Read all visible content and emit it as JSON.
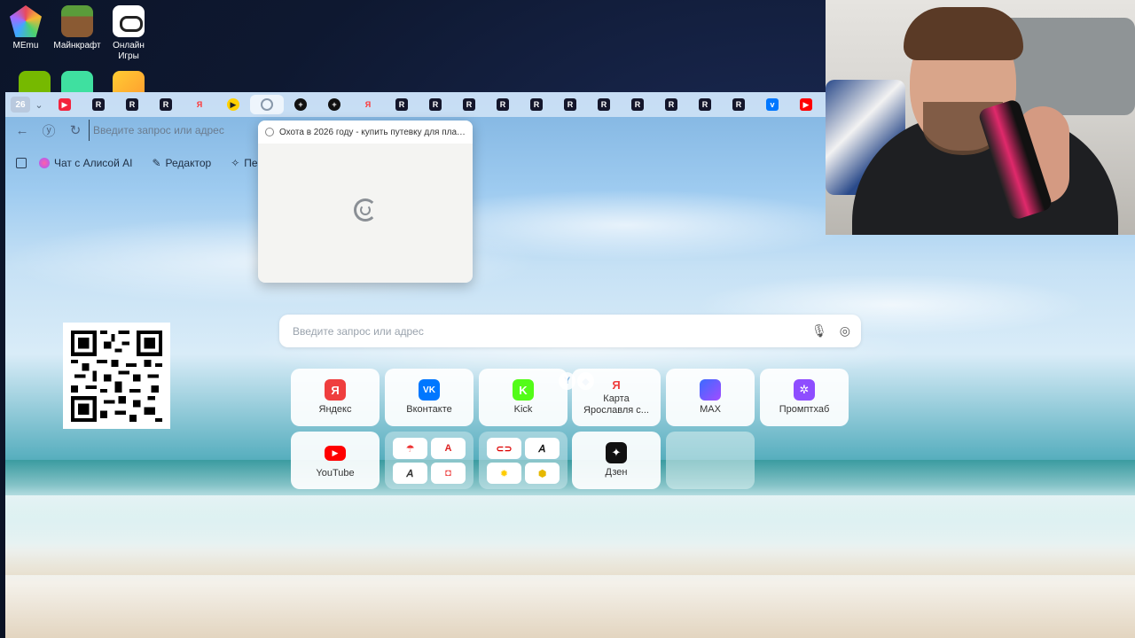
{
  "desktop": {
    "icons": [
      {
        "label": "MEmu"
      },
      {
        "label": "Майнкрафт"
      },
      {
        "label": "Онлайн Игры"
      }
    ]
  },
  "browser": {
    "tab_counter": "26",
    "address_placeholder": "Введите запрос или адрес",
    "bookmarks": {
      "alice": "Чат с Алисой AI",
      "editor": "Редактор",
      "third": "Пе"
    },
    "tab_preview": {
      "title": "Охота в 2026 году - купить путевку для плат..."
    },
    "search_placeholder": "Введите запрос или адрес",
    "tiles": [
      {
        "label": "Яндекс",
        "glyph": "Я"
      },
      {
        "label": "Вконтакте",
        "glyph": "VK"
      },
      {
        "label": "Kick",
        "glyph": "K"
      },
      {
        "label": "Карта Ярославля с...",
        "glyph": "Я"
      },
      {
        "label": "MAX",
        "glyph": ""
      },
      {
        "label": "Промптхаб",
        "glyph": "✲"
      },
      {
        "label": "YouTube",
        "glyph": "▶"
      },
      {
        "label": "Дзен",
        "glyph": "✦"
      }
    ]
  }
}
